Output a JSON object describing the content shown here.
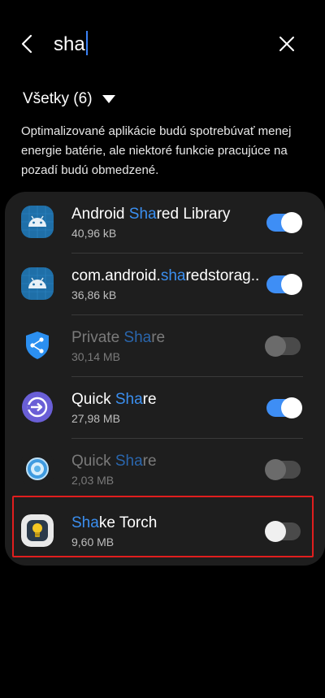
{
  "header": {
    "query": "sha"
  },
  "filter": {
    "label": "Všetky (6)"
  },
  "description": "Optimalizované aplikácie budú spotrebúvať menej energie batérie, ale niektoré funkcie pracujúce na pozadí budú obmedzené.",
  "apps": [
    {
      "pre": "Android ",
      "match": "Sha",
      "post": "red Library",
      "size": "40,96 kB",
      "enabled": true,
      "icon": "android-icon"
    },
    {
      "pre": "com.android.",
      "match": "sha",
      "post": "redstorag..",
      "size": "36,86 kB",
      "enabled": true,
      "icon": "android-icon"
    },
    {
      "pre": "Private ",
      "match": "Sha",
      "post": "re",
      "size": "30,14 MB",
      "enabled": false,
      "icon": "private-share-icon"
    },
    {
      "pre": "Quick ",
      "match": "Sha",
      "post": "re",
      "size": "27,98 MB",
      "enabled": true,
      "icon": "quick-share-icon"
    },
    {
      "pre": "Quick ",
      "match": "Sha",
      "post": "re",
      "size": "2,03 MB",
      "enabled": false,
      "icon": "quick-share-legacy-icon"
    },
    {
      "pre": "",
      "match": "Sha",
      "post": "ke Torch",
      "size": "9,60 MB",
      "enabled": false,
      "icon": "torch-icon"
    }
  ],
  "colors": {
    "accent": "#3e8ef5",
    "highlight_border": "#e01e1e",
    "card_bg": "#1e1e1e"
  }
}
